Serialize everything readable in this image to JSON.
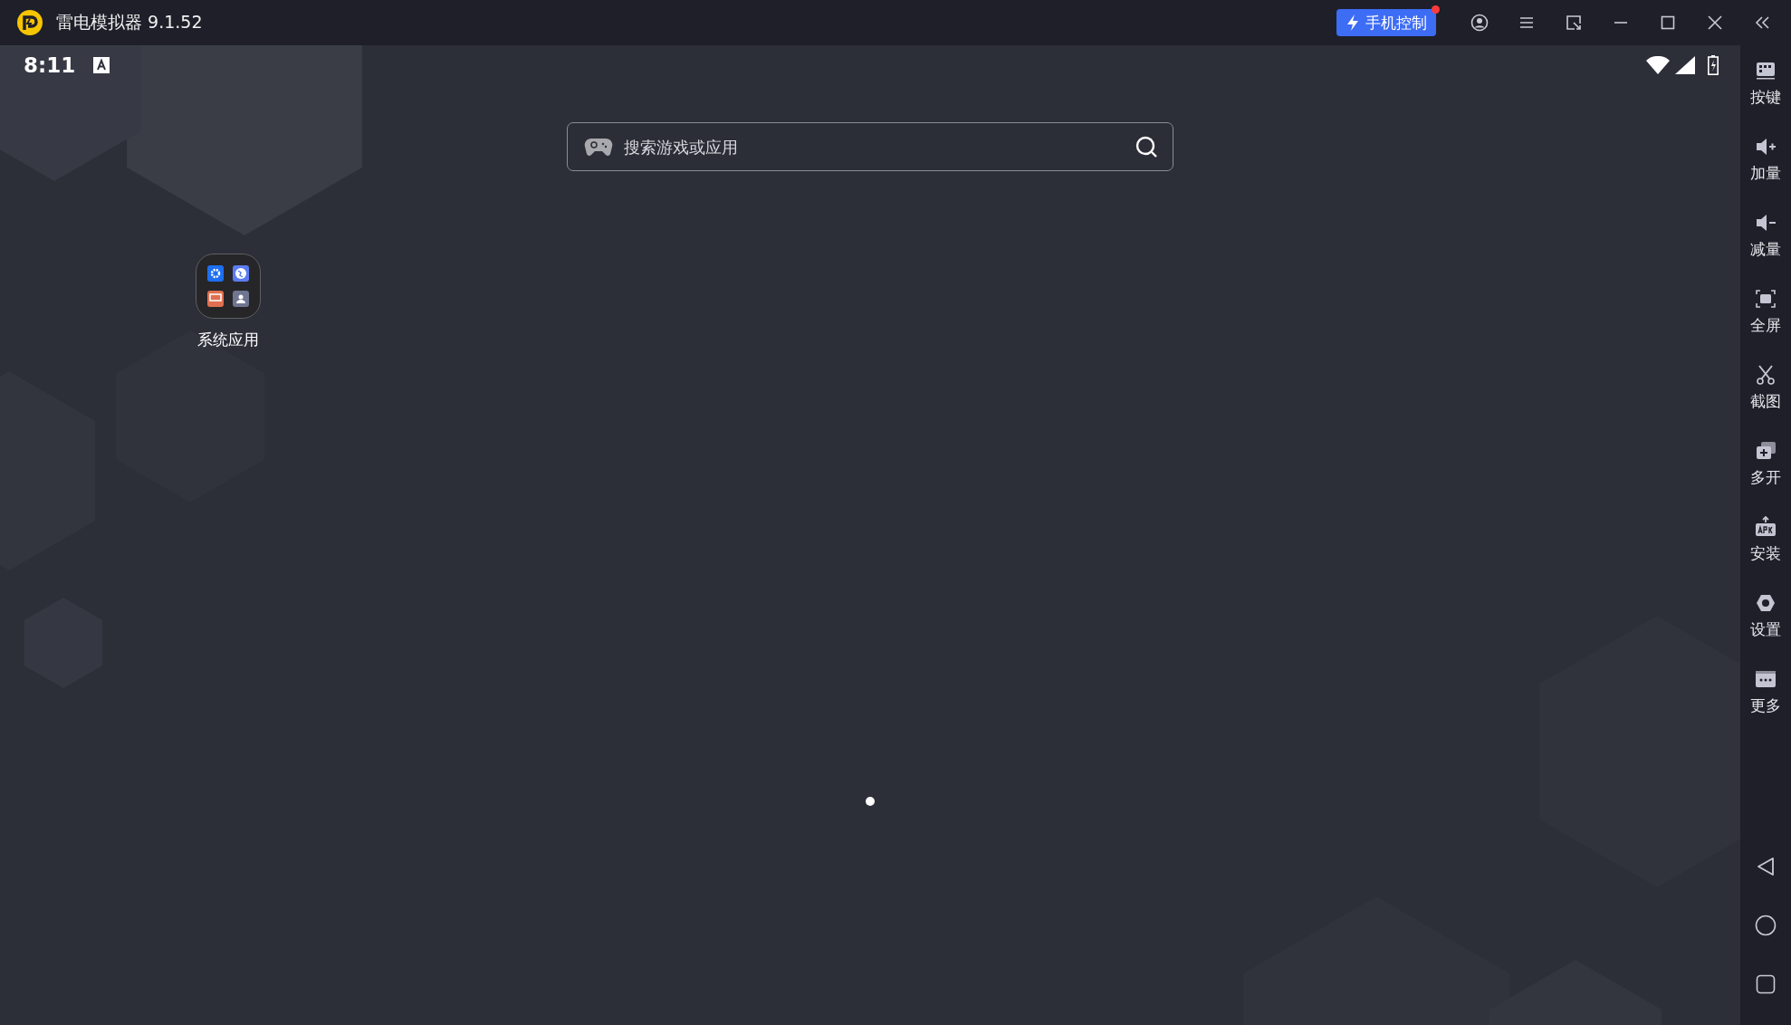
{
  "window": {
    "title": "雷电模拟器 9.1.52"
  },
  "phone_control_button": {
    "label": "手机控制",
    "notification": true
  },
  "status_bar": {
    "time": "8:11"
  },
  "search": {
    "placeholder": "搜索游戏或应用"
  },
  "desktop": {
    "apps": [
      {
        "label": "系统应用"
      }
    ]
  },
  "page_indicator": {
    "pages": [
      {
        "selected": true
      }
    ]
  },
  "sidebar": {
    "tools": [
      {
        "kind": "keymap",
        "label": "按键"
      },
      {
        "kind": "volume_up",
        "label": "加量"
      },
      {
        "kind": "volume_down",
        "label": "减量"
      },
      {
        "kind": "fullscreen",
        "label": "全屏"
      },
      {
        "kind": "screenshot",
        "label": "截图"
      },
      {
        "kind": "multi",
        "label": "多开"
      },
      {
        "kind": "install",
        "label": "安装"
      },
      {
        "kind": "settings",
        "label": "设置"
      },
      {
        "kind": "more",
        "label": "更多"
      }
    ]
  }
}
